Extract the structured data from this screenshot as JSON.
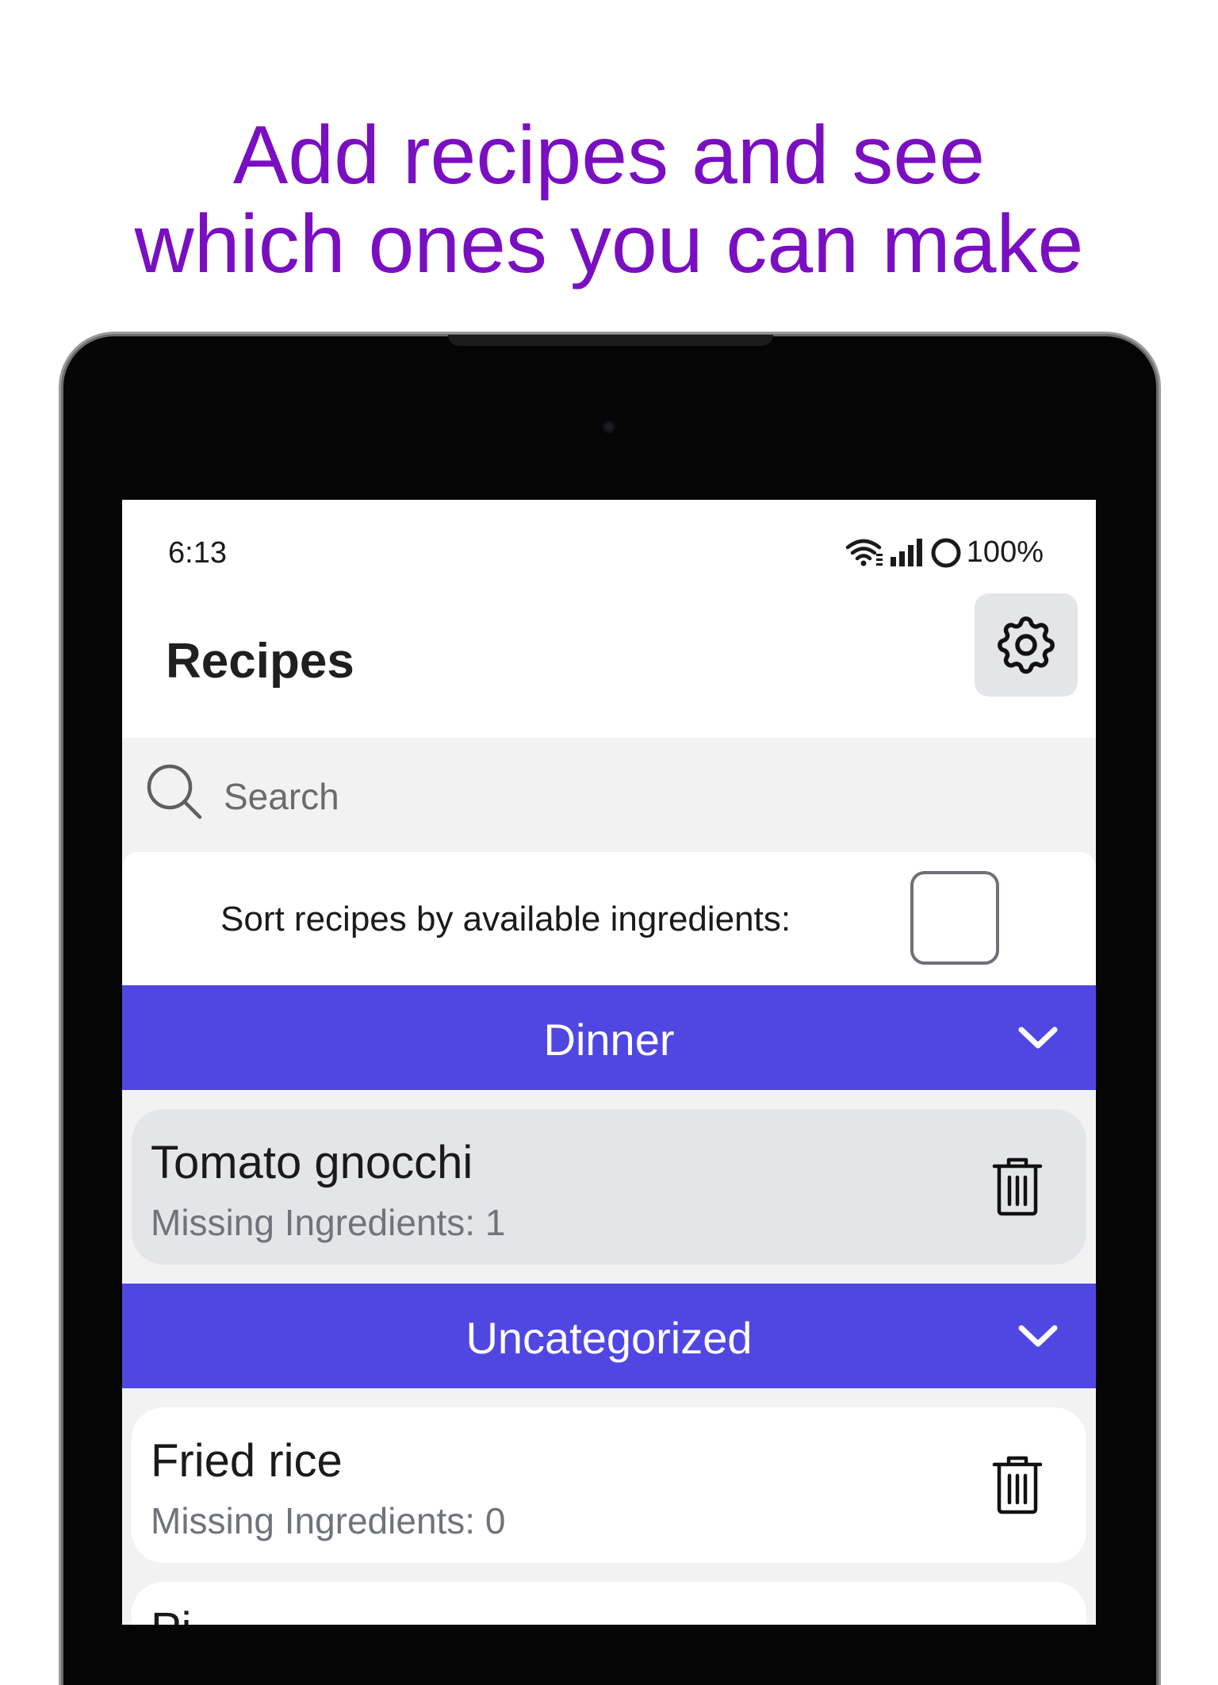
{
  "headline": {
    "line1": "Add recipes and see",
    "line2": "which ones you can make"
  },
  "status_bar": {
    "time": "6:13",
    "battery": "100%",
    "icons": [
      "wifi-icon",
      "signal-icon",
      "battery-ring-icon"
    ]
  },
  "app_bar": {
    "title": "Recipes",
    "settings_icon": "gear-icon"
  },
  "search": {
    "placeholder": "Search",
    "value": ""
  },
  "sort": {
    "label": "Sort recipes by available ingredients:",
    "checked": false
  },
  "categories": [
    {
      "name": "Dinner",
      "recipes": [
        {
          "name": "Tomato gnocchi",
          "missing": "Missing Ingredients: 1"
        }
      ]
    },
    {
      "name": "Uncategorized",
      "recipes": [
        {
          "name": "Fried rice",
          "missing": "Missing Ingredients: 0"
        },
        {
          "name": "Pi",
          "missing": ""
        }
      ]
    }
  ],
  "colors": {
    "headline": "#7a0fc2",
    "category_header": "#5047e3",
    "card_highlight": "#e4e5e9",
    "secondary_text": "#70737b"
  }
}
